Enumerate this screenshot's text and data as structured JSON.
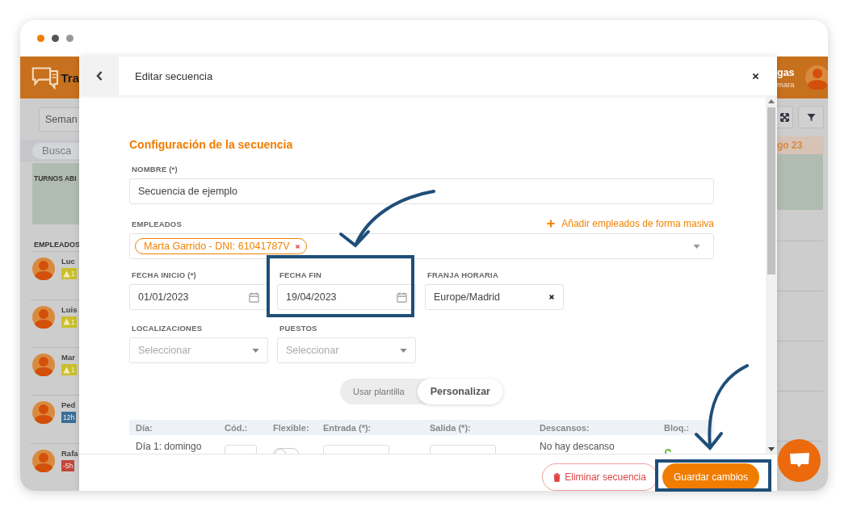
{
  "background_app": {
    "brand": "Tra",
    "user_name": "gas",
    "user_role": "mara",
    "week_button": "Seman",
    "search_placeholder": "Busca",
    "open_shifts": "TURNOS ABI",
    "employees_heading": "EMPLEADOS",
    "day_header": "go 23",
    "employees": [
      {
        "name": "Luc",
        "badge": "1",
        "kind": "warning"
      },
      {
        "name": "Luis",
        "badge": "1",
        "kind": "warning"
      },
      {
        "name": "Mar",
        "badge": "1",
        "kind": "warning"
      },
      {
        "name": "Ped",
        "badge": "12h",
        "kind": "hours"
      },
      {
        "name": "Rafa",
        "badge": "-5h",
        "kind": "negative"
      }
    ]
  },
  "modal": {
    "title": "Editar secuencia",
    "section_title": "Configuración de la secuencia",
    "name_field": {
      "label": "NOMBRE (*)",
      "value": "Secuencia de ejemplo"
    },
    "employees_field": {
      "label": "EMPLEADOS",
      "bulk_add_link": "Añadir empleados de forma masiva",
      "tags": [
        "Marta Garrido - DNI: 61041787V"
      ]
    },
    "start_date": {
      "label": "FECHA INICIO (*)",
      "value": "01/01/2023"
    },
    "end_date": {
      "label": "FECHA FIN",
      "value": "19/04/2023"
    },
    "timezone": {
      "label": "FRANJA HORARIA",
      "value": "Europe/Madrid"
    },
    "locations": {
      "label": "LOCALIZACIONES",
      "placeholder": "Seleccionar"
    },
    "positions": {
      "label": "PUESTOS",
      "placeholder": "Seleccionar"
    },
    "mode_toggle": [
      {
        "label": "Usar plantilla",
        "selected": false
      },
      {
        "label": "Personalizar",
        "selected": true
      }
    ],
    "table": {
      "columns": [
        "Día:",
        "Cód.:",
        "Flexible:",
        "Entrada (*):",
        "Salida (*):",
        "Descansos:",
        "Bloq.:"
      ],
      "rows": [
        {
          "day": "Día 1: domingo",
          "flexible": false,
          "breaks": "No hay descanso"
        }
      ]
    },
    "delete_button": "Eliminar secuencia",
    "save_button": "Guardar cambios"
  }
}
